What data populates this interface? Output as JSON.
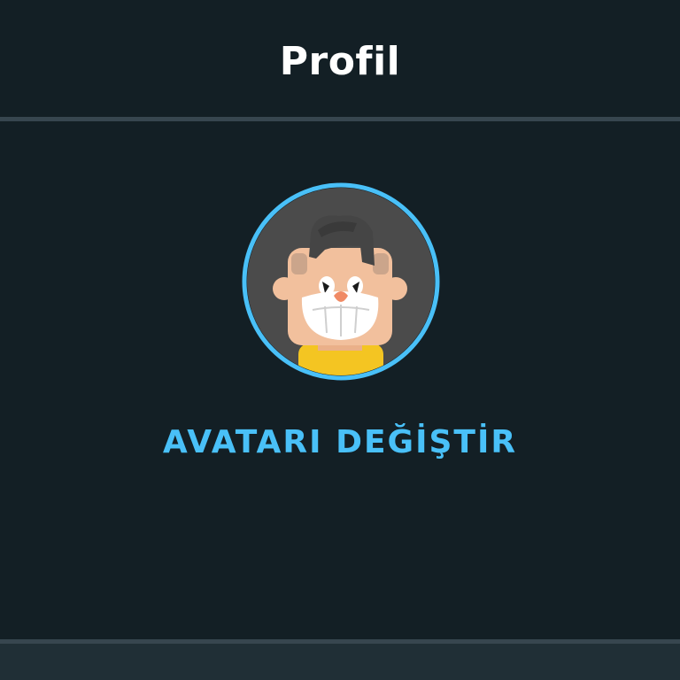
{
  "header": {
    "title": "Profil"
  },
  "avatar": {
    "icon": "avatar-character-icon",
    "ring_color": "#49c0f8"
  },
  "actions": {
    "change_avatar_label": "AVATARI DEĞİŞTİR"
  },
  "colors": {
    "background": "#131f25",
    "divider": "#37464f",
    "accent": "#49c0f8",
    "title": "#ffffff"
  }
}
